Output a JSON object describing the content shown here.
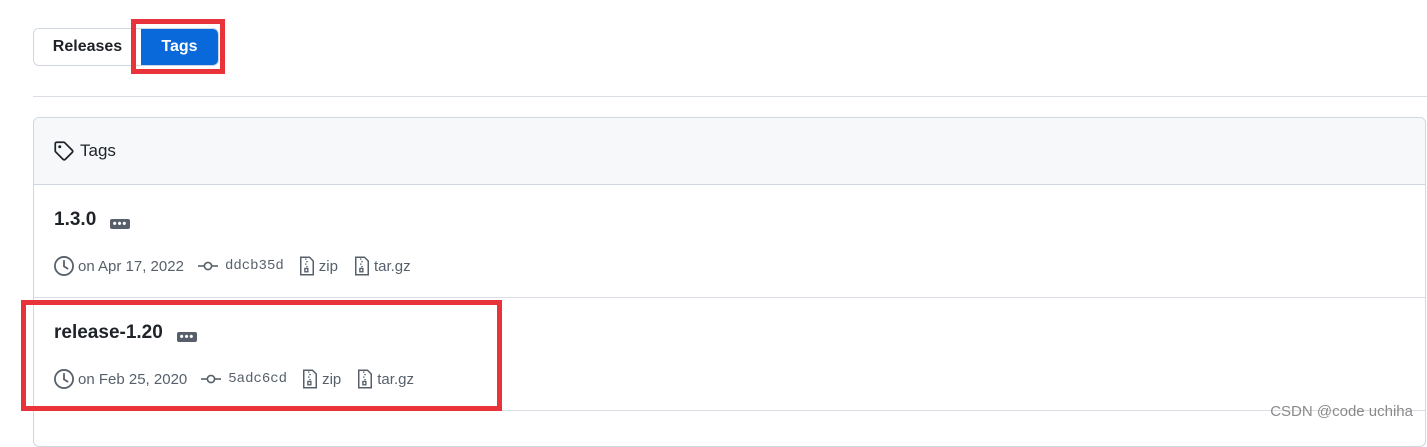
{
  "toggle": {
    "releases_label": "Releases",
    "tags_label": "Tags"
  },
  "panel": {
    "header_title": "Tags"
  },
  "tags": [
    {
      "name": "1.3.0",
      "date": "on Apr 17, 2022",
      "commit": "ddcb35d",
      "zip_label": "zip",
      "targz_label": "tar.gz"
    },
    {
      "name": "release-1.20",
      "date": "on Feb 25, 2020",
      "commit": "5adc6cd",
      "zip_label": "zip",
      "targz_label": "tar.gz"
    }
  ],
  "watermark": "CSDN @code uchiha",
  "colors": {
    "accent": "#0969da",
    "highlight": "#e8333a",
    "muted": "#57606a"
  }
}
